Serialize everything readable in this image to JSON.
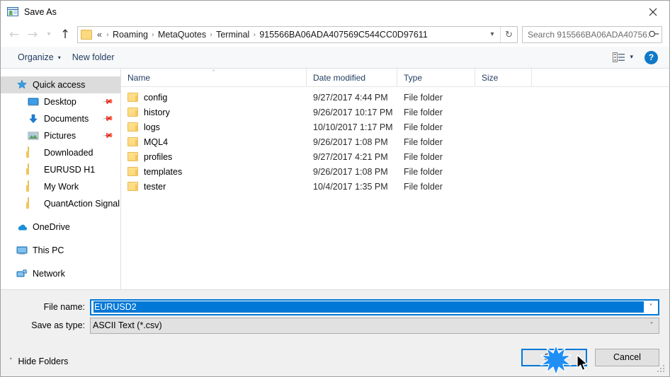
{
  "window": {
    "title": "Save As",
    "title_icon": "save-as-window-icon",
    "close_icon": "close-icon"
  },
  "navigation": {
    "back_icon": "back-arrow-icon",
    "forward_icon": "forward-arrow-icon",
    "recent_icon": "chevron-down-icon",
    "up_icon": "up-arrow-icon",
    "folder_icon": "folder-icon",
    "breadcrumb_prefix": "«",
    "crumbs": [
      "Roaming",
      "MetaQuotes",
      "Terminal",
      "915566BA06ADA407569C544CC0D97611"
    ],
    "separator": "›",
    "dropdown_icon": "chevron-down-icon",
    "refresh_icon": "refresh-icon",
    "refresh_glyph": "↻"
  },
  "search": {
    "placeholder": "Search 915566BA06ADA40756...",
    "value": "",
    "icon": "search-icon"
  },
  "commandbar": {
    "organize_label": "Organize",
    "organize_caret": "▾",
    "new_folder_label": "New folder",
    "view_icon": "view-options-icon",
    "view_caret": "▾",
    "help_label": "?",
    "help_icon": "help-icon"
  },
  "sidebar": {
    "items": [
      {
        "label": "Quick access",
        "icon": "star-icon",
        "level": "root",
        "selected": true,
        "pinned": false
      },
      {
        "label": "Desktop",
        "icon": "desktop-icon",
        "level": "child",
        "selected": false,
        "pinned": true
      },
      {
        "label": "Documents",
        "icon": "documents-icon",
        "level": "child",
        "selected": false,
        "pinned": true
      },
      {
        "label": "Pictures",
        "icon": "pictures-icon",
        "level": "child",
        "selected": false,
        "pinned": true
      },
      {
        "label": "Downloaded",
        "icon": "folder-icon",
        "level": "child",
        "selected": false,
        "pinned": false
      },
      {
        "label": "EURUSD H1",
        "icon": "folder-icon",
        "level": "child",
        "selected": false,
        "pinned": false
      },
      {
        "label": "My Work",
        "icon": "folder-icon",
        "level": "child",
        "selected": false,
        "pinned": false
      },
      {
        "label": "QuantAction Signal",
        "icon": "folder-icon",
        "level": "child",
        "selected": false,
        "pinned": false
      },
      {
        "label": "OneDrive",
        "icon": "onedrive-icon",
        "level": "root",
        "selected": false,
        "pinned": false,
        "group": true
      },
      {
        "label": "This PC",
        "icon": "this-pc-icon",
        "level": "root",
        "selected": false,
        "pinned": false,
        "group": true
      },
      {
        "label": "Network",
        "icon": "network-icon",
        "level": "root",
        "selected": false,
        "pinned": false,
        "group": true
      }
    ]
  },
  "filelist": {
    "columns": [
      {
        "label": "Name",
        "sorted": true,
        "sort_caret": "˄"
      },
      {
        "label": "Date modified",
        "sorted": false
      },
      {
        "label": "Type",
        "sorted": false
      },
      {
        "label": "Size",
        "sorted": false
      }
    ],
    "rows": [
      {
        "name": "config",
        "date": "9/27/2017 4:44 PM",
        "type": "File folder",
        "size": ""
      },
      {
        "name": "history",
        "date": "9/26/2017 10:17 PM",
        "type": "File folder",
        "size": ""
      },
      {
        "name": "logs",
        "date": "10/10/2017 1:17 PM",
        "type": "File folder",
        "size": ""
      },
      {
        "name": "MQL4",
        "date": "9/26/2017 1:08 PM",
        "type": "File folder",
        "size": ""
      },
      {
        "name": "profiles",
        "date": "9/27/2017 4:21 PM",
        "type": "File folder",
        "size": ""
      },
      {
        "name": "templates",
        "date": "9/26/2017 1:08 PM",
        "type": "File folder",
        "size": ""
      },
      {
        "name": "tester",
        "date": "10/4/2017 1:35 PM",
        "type": "File folder",
        "size": ""
      }
    ]
  },
  "form": {
    "filename_label": "File name:",
    "filename_value": "EURUSD2",
    "filetype_label": "Save as type:",
    "filetype_value": "ASCII Text (*.csv)",
    "caret": "˅"
  },
  "buttons": {
    "hide_folders_label": "Hide Folders",
    "hide_folders_caret": "˄",
    "save_label": "Save",
    "cancel_label": "Cancel"
  },
  "colors": {
    "accent": "#0078d7",
    "folder": "#fcd980",
    "header_text": "#1f3a5f",
    "dialog_bg": "#f0f0f0"
  }
}
